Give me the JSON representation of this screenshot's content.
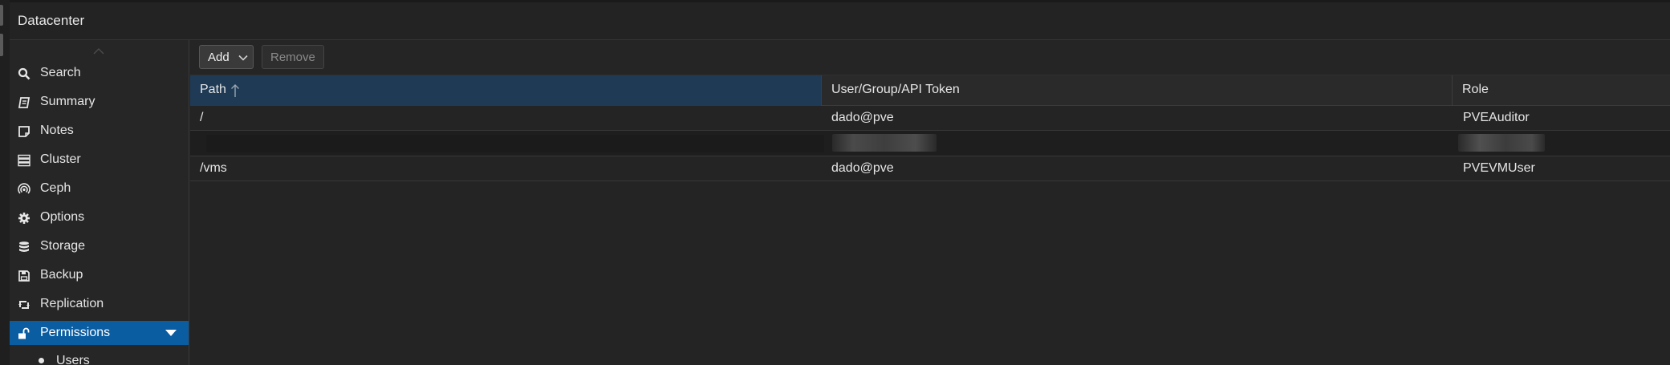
{
  "header": {
    "title": "Datacenter"
  },
  "sidebar": {
    "items": [
      {
        "label": "Search",
        "icon": "search-icon"
      },
      {
        "label": "Summary",
        "icon": "book-icon"
      },
      {
        "label": "Notes",
        "icon": "note-icon"
      },
      {
        "label": "Cluster",
        "icon": "server-icon"
      },
      {
        "label": "Ceph",
        "icon": "ceph-icon"
      },
      {
        "label": "Options",
        "icon": "gear-icon"
      },
      {
        "label": "Storage",
        "icon": "database-icon"
      },
      {
        "label": "Backup",
        "icon": "floppy-icon"
      },
      {
        "label": "Replication",
        "icon": "retweet-icon"
      },
      {
        "label": "Permissions",
        "icon": "unlock-icon",
        "active": true
      }
    ],
    "subitems": [
      {
        "label": "Users"
      }
    ]
  },
  "toolbar": {
    "add_label": "Add",
    "remove_label": "Remove"
  },
  "grid": {
    "columns": [
      {
        "label": "Path"
      },
      {
        "label": "User/Group/API Token"
      },
      {
        "label": "Role"
      }
    ],
    "rows": [
      {
        "path": "/",
        "user": "dado@pve",
        "role": "PVEAuditor"
      },
      {
        "path": "",
        "user": "",
        "role": "",
        "redacted": true
      },
      {
        "path": "/vms",
        "user": "dado@pve",
        "role": "PVEVMUser"
      }
    ]
  },
  "colors": {
    "accent": "#0b5da2",
    "sorted_header": "#1e3a55",
    "background": "#242424"
  }
}
